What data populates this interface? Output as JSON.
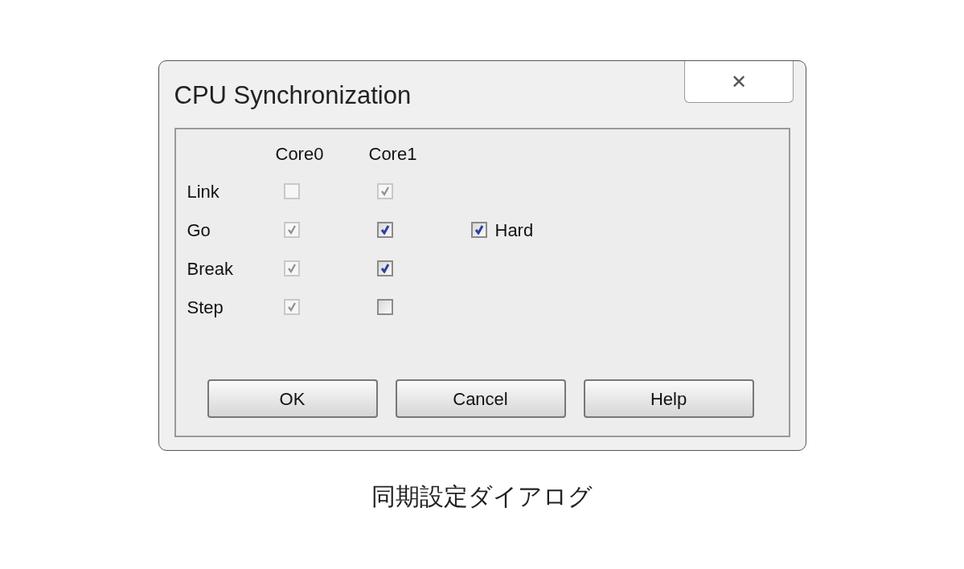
{
  "window": {
    "title": "CPU Synchronization",
    "close_glyph": "✕"
  },
  "columns": [
    "Core0",
    "Core1"
  ],
  "rows": [
    {
      "label": "Link",
      "cells": [
        {
          "checked": false,
          "disabled": true
        },
        {
          "checked": true,
          "disabled": true
        }
      ]
    },
    {
      "label": "Go",
      "cells": [
        {
          "checked": true,
          "disabled": true
        },
        {
          "checked": true,
          "disabled": false
        }
      ],
      "extra": {
        "label": "Hard",
        "checked": true,
        "disabled": false
      }
    },
    {
      "label": "Break",
      "cells": [
        {
          "checked": true,
          "disabled": true
        },
        {
          "checked": true,
          "disabled": false
        }
      ]
    },
    {
      "label": "Step",
      "cells": [
        {
          "checked": true,
          "disabled": true
        },
        {
          "checked": false,
          "disabled": false
        }
      ]
    }
  ],
  "buttons": [
    "OK",
    "Cancel",
    "Help"
  ],
  "caption": "同期設定ダイアログ"
}
